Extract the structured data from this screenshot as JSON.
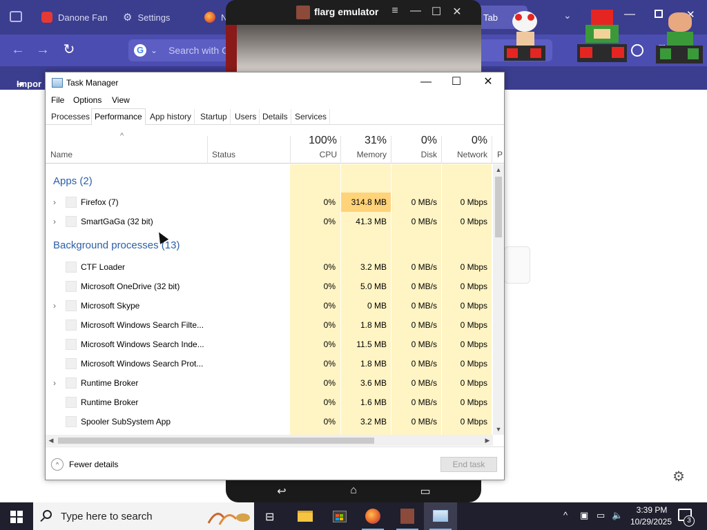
{
  "browser": {
    "tabs": [
      {
        "label": "Danone Fan",
        "icon": "youtube-icon"
      },
      {
        "label": "Settings",
        "icon": "gear-icon"
      },
      {
        "label": "N",
        "icon": "firefox-icon"
      },
      {
        "label": "Tab",
        "icon": "tab-icon"
      }
    ],
    "url_placeholder": "Search with Go",
    "bookmark_label": "Impor"
  },
  "emulator": {
    "title": "flarg emulator"
  },
  "task_manager": {
    "title": "Task Manager",
    "menu": [
      "File",
      "Options",
      "View"
    ],
    "tabs": [
      "Processes",
      "Performance",
      "App history",
      "Startup",
      "Users",
      "Details",
      "Services"
    ],
    "active_tab": "Performance",
    "columns": {
      "name": "Name",
      "status": "Status",
      "cpu": {
        "percent": "100%",
        "label": "CPU"
      },
      "memory": {
        "percent": "31%",
        "label": "Memory"
      },
      "disk": {
        "percent": "0%",
        "label": "Disk"
      },
      "network": {
        "percent": "0%",
        "label": "Network"
      },
      "power": {
        "label": "P"
      }
    },
    "groups": [
      {
        "title": "Apps",
        "count": "(2)",
        "rows": [
          {
            "name": "Firefox (7)",
            "expandable": true,
            "cpu": "0%",
            "memory": "314.8 MB",
            "disk": "0 MB/s",
            "network": "0 Mbps"
          },
          {
            "name": "SmartGaGa (32 bit)",
            "expandable": true,
            "cpu": "0%",
            "memory": "41.3 MB",
            "disk": "0 MB/s",
            "network": "0 Mbps"
          }
        ]
      },
      {
        "title": "Background processes",
        "count": "(13)",
        "rows": [
          {
            "name": "CTF Loader",
            "expandable": false,
            "cpu": "0%",
            "memory": "3.2 MB",
            "disk": "0 MB/s",
            "network": "0 Mbps"
          },
          {
            "name": "Microsoft OneDrive (32 bit)",
            "expandable": false,
            "cpu": "0%",
            "memory": "5.0 MB",
            "disk": "0 MB/s",
            "network": "0 Mbps"
          },
          {
            "name": "Microsoft Skype",
            "expandable": true,
            "cpu": "0%",
            "memory": "0 MB",
            "disk": "0 MB/s",
            "network": "0 Mbps"
          },
          {
            "name": "Microsoft Windows Search Filte...",
            "expandable": false,
            "cpu": "0%",
            "memory": "1.8 MB",
            "disk": "0 MB/s",
            "network": "0 Mbps"
          },
          {
            "name": "Microsoft Windows Search Inde...",
            "expandable": false,
            "cpu": "0%",
            "memory": "11.5 MB",
            "disk": "0 MB/s",
            "network": "0 Mbps"
          },
          {
            "name": "Microsoft Windows Search Prot...",
            "expandable": false,
            "cpu": "0%",
            "memory": "1.8 MB",
            "disk": "0 MB/s",
            "network": "0 Mbps"
          },
          {
            "name": "Runtime Broker",
            "expandable": true,
            "cpu": "0%",
            "memory": "3.6 MB",
            "disk": "0 MB/s",
            "network": "0 Mbps"
          },
          {
            "name": "Runtime Broker",
            "expandable": false,
            "cpu": "0%",
            "memory": "1.6 MB",
            "disk": "0 MB/s",
            "network": "0 Mbps"
          },
          {
            "name": "Spooler SubSystem App",
            "expandable": false,
            "cpu": "0%",
            "memory": "3.2 MB",
            "disk": "0 MB/s",
            "network": "0 Mbps"
          }
        ]
      }
    ],
    "footer": {
      "fewer_details": "Fewer details",
      "end_task": "End task"
    }
  },
  "taskbar": {
    "search_placeholder": "Type here to search",
    "time": "3:39 PM",
    "date": "10/29/2025",
    "notification_count": "3"
  },
  "colors": {
    "browser_tabbar": "#3b3d8f",
    "browser_navbar": "#4b4db0",
    "group_title": "#2b5fa6",
    "cpu_heat": "#fff4c4",
    "memory_heat_high": "#ffd37a",
    "taskbar": "#1f1f2e"
  }
}
